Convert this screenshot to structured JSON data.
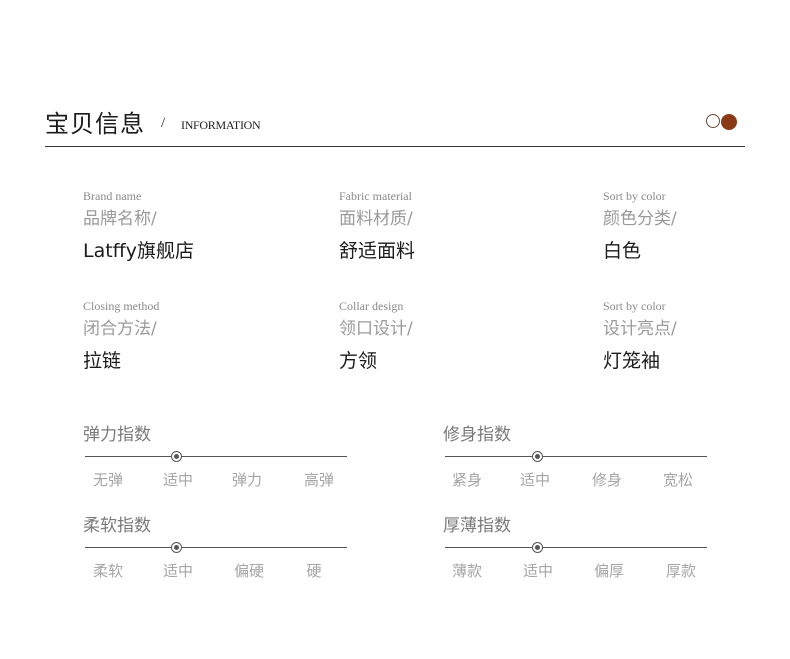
{
  "header": {
    "title": "宝贝信息",
    "slash": "/",
    "subtitle": "INFORMATION",
    "accent_color": "#8a3a14"
  },
  "attributes": [
    {
      "en": "Brand name",
      "cn": "品牌名称/",
      "value": "Latffy旗舰店"
    },
    {
      "en": "Fabric material",
      "cn": "面料材质/",
      "value": "舒适面料"
    },
    {
      "en": "Sort by color",
      "cn": "颜色分类/",
      "value": "白色"
    },
    {
      "en": "Closing method",
      "cn": "闭合方法/",
      "value": "拉链"
    },
    {
      "en": "Collar design",
      "cn": "领口设计/",
      "value": "方领"
    },
    {
      "en": "Sort by color",
      "cn": "设计亮点/",
      "value": "灯笼袖"
    }
  ],
  "scales": [
    {
      "title": "弹力指数",
      "options": [
        "无弹",
        "适中",
        "弹力",
        "高弹"
      ],
      "selected": "适中",
      "selected_index": 1
    },
    {
      "title": "修身指数",
      "options": [
        "紧身",
        "适中",
        "修身",
        "宽松"
      ],
      "selected": "适中",
      "selected_index": 1
    },
    {
      "title": "柔软指数",
      "options": [
        "柔软",
        "适中",
        "偏硬",
        "硬"
      ],
      "selected": "适中",
      "selected_index": 1
    },
    {
      "title": "厚薄指数",
      "options": [
        "薄款",
        "适中",
        "偏厚",
        "厚款"
      ],
      "selected": "适中",
      "selected_index": 1
    }
  ]
}
